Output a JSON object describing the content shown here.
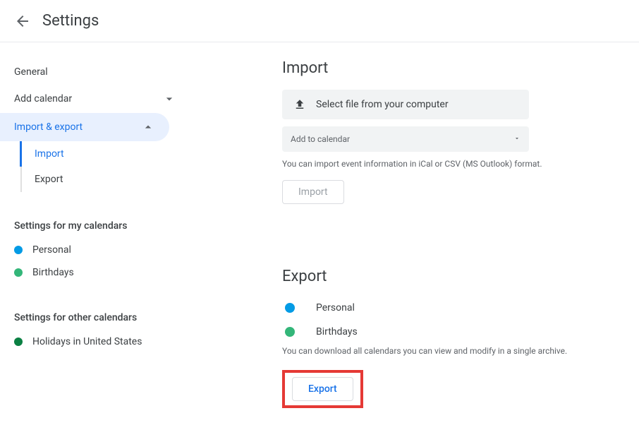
{
  "header": {
    "title": "Settings"
  },
  "sidebar": {
    "general": "General",
    "add_calendar": "Add calendar",
    "import_export": "Import & export",
    "sub_import": "Import",
    "sub_export": "Export",
    "settings_my": "Settings for my calendars",
    "my_cals": [
      {
        "label": "Personal",
        "color": "#039be5"
      },
      {
        "label": "Birthdays",
        "color": "#33b679"
      }
    ],
    "settings_other": "Settings for other calendars",
    "other_cals": [
      {
        "label": "Holidays in United States",
        "color": "#0b8043"
      }
    ]
  },
  "import": {
    "title": "Import",
    "file_select": "Select file from your computer",
    "dropdown_label": "Add to calendar",
    "help": "You can import event information in iCal or CSV (MS Outlook) format.",
    "button": "Import"
  },
  "export": {
    "title": "Export",
    "cals": [
      {
        "label": "Personal",
        "color": "#039be5"
      },
      {
        "label": "Birthdays",
        "color": "#33b679"
      }
    ],
    "help": "You can download all calendars you can view and modify in a single archive.",
    "button": "Export"
  }
}
